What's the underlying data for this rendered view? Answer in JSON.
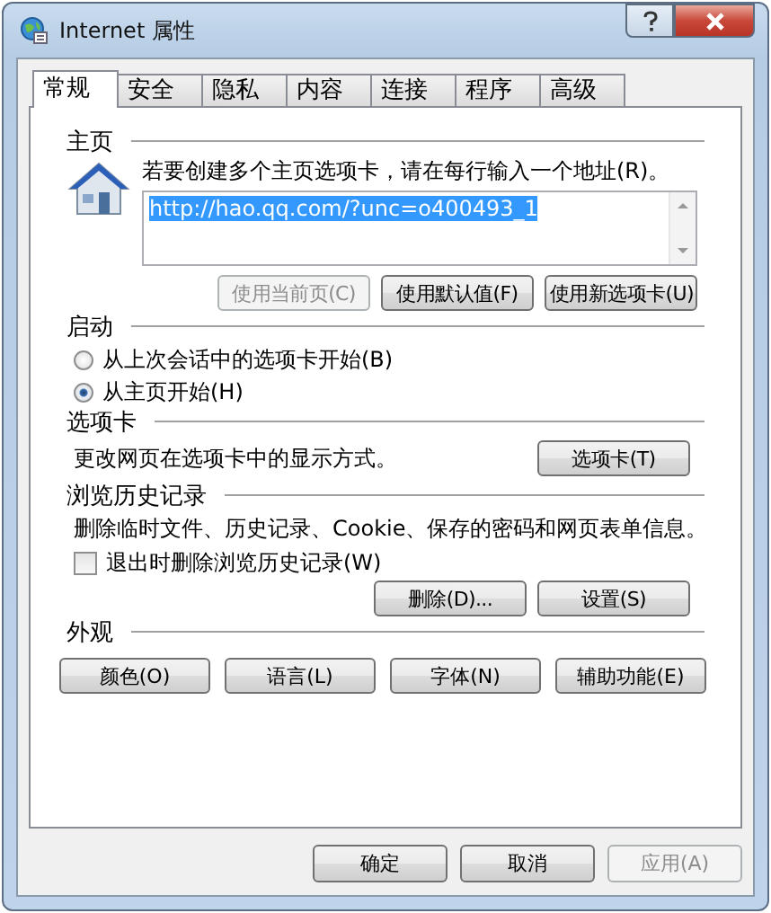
{
  "window": {
    "title": "Internet 属性"
  },
  "tabs": [
    {
      "label": "常规",
      "selected": true
    },
    {
      "label": "安全",
      "selected": false
    },
    {
      "label": "隐私",
      "selected": false
    },
    {
      "label": "内容",
      "selected": false
    },
    {
      "label": "连接",
      "selected": false
    },
    {
      "label": "程序",
      "selected": false
    },
    {
      "label": "高级",
      "selected": false
    }
  ],
  "homepage": {
    "heading": "主页",
    "instruction": "若要创建多个主页选项卡，请在每行输入一个地址(R)。",
    "url": "http://hao.qq.com/?unc=o400493_1",
    "buttons": [
      {
        "label": "使用当前页(C)",
        "disabled": true
      },
      {
        "label": "使用默认值(F)",
        "disabled": false
      },
      {
        "label": "使用新选项卡(U)",
        "disabled": false
      }
    ]
  },
  "startup": {
    "heading": "启动",
    "options": [
      {
        "label": "从上次会话中的选项卡开始(B)",
        "selected": false
      },
      {
        "label": "从主页开始(H)",
        "selected": true
      }
    ]
  },
  "tab_settings": {
    "heading": "选项卡",
    "description": "更改网页在选项卡中的显示方式。",
    "button": "选项卡(T)"
  },
  "history": {
    "heading": "浏览历史记录",
    "description": "删除临时文件、历史记录、Cookie、保存的密码和网页表单信息。",
    "checkbox": {
      "label": "退出时删除浏览历史记录(W)",
      "checked": false
    },
    "buttons": [
      "删除(D)...",
      "设置(S)"
    ]
  },
  "appearance": {
    "heading": "外观",
    "buttons": [
      "颜色(O)",
      "语言(L)",
      "字体(N)",
      "辅助功能(E)"
    ]
  },
  "footer": [
    {
      "label": "确定",
      "disabled": false
    },
    {
      "label": "取消",
      "disabled": false
    },
    {
      "label": "应用(A)",
      "disabled": true
    }
  ]
}
